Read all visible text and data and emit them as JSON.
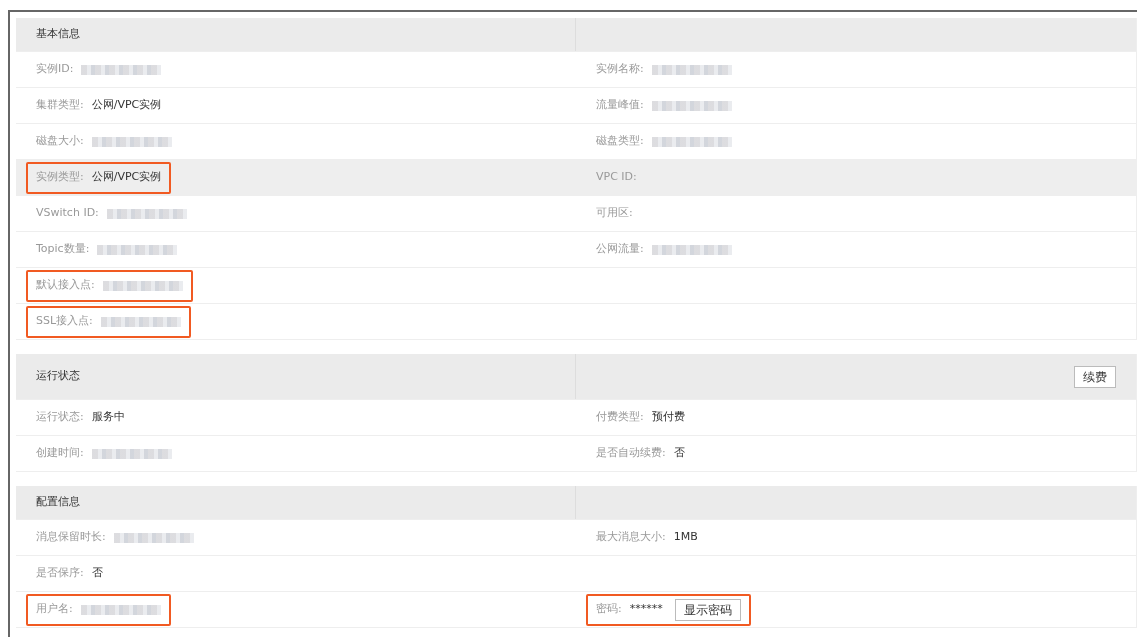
{
  "sections": [
    {
      "title": "基本信息",
      "rows": [
        {
          "shaded": false,
          "cells": [
            {
              "label": "实例ID:",
              "kind": "redacted",
              "highlighted": false
            },
            {
              "label": "实例名称:",
              "kind": "redacted",
              "highlighted": false
            }
          ]
        },
        {
          "shaded": false,
          "cells": [
            {
              "label": "集群类型:",
              "kind": "text",
              "value": "公网/VPC实例",
              "highlighted": false
            },
            {
              "label": "流量峰值:",
              "kind": "redacted",
              "highlighted": false
            }
          ]
        },
        {
          "shaded": false,
          "cells": [
            {
              "label": "磁盘大小:",
              "kind": "redacted",
              "highlighted": false
            },
            {
              "label": "磁盘类型:",
              "kind": "redacted",
              "highlighted": false
            }
          ]
        },
        {
          "shaded": true,
          "cells": [
            {
              "label": "实例类型:",
              "kind": "text",
              "value": "公网/VPC实例",
              "highlighted": true
            },
            {
              "label": "VPC ID:",
              "kind": "empty",
              "highlighted": false
            }
          ]
        },
        {
          "shaded": false,
          "cells": [
            {
              "label": "VSwitch ID:",
              "kind": "redacted",
              "highlighted": false
            },
            {
              "label": "可用区:",
              "kind": "empty",
              "highlighted": false
            }
          ]
        },
        {
          "shaded": false,
          "cells": [
            {
              "label": "Topic数量:",
              "kind": "redacted",
              "highlighted": false
            },
            {
              "label": "公网流量:",
              "kind": "redacted",
              "highlighted": false
            }
          ]
        },
        {
          "shaded": false,
          "cells": [
            {
              "label": "默认接入点:",
              "kind": "redacted",
              "highlighted": true
            }
          ]
        },
        {
          "shaded": false,
          "cells": [
            {
              "label": "SSL接入点:",
              "kind": "redacted",
              "highlighted": true
            }
          ]
        }
      ]
    },
    {
      "title": "运行状态",
      "action": "续费",
      "rows": [
        {
          "shaded": false,
          "cells": [
            {
              "label": "运行状态:",
              "kind": "text",
              "value": "服务中",
              "highlighted": false
            },
            {
              "label": "付费类型:",
              "kind": "text",
              "value": "预付费",
              "highlighted": false
            }
          ]
        },
        {
          "shaded": false,
          "cells": [
            {
              "label": "创建时间:",
              "kind": "redacted",
              "highlighted": false
            },
            {
              "label": "是否自动续费:",
              "kind": "text",
              "value": "否",
              "highlighted": false
            }
          ]
        }
      ]
    },
    {
      "title": "配置信息",
      "rows": [
        {
          "shaded": false,
          "cells": [
            {
              "label": "消息保留时长:",
              "kind": "redacted",
              "highlighted": false
            },
            {
              "label": "最大消息大小:",
              "kind": "text",
              "value": "1MB",
              "highlighted": false
            }
          ]
        },
        {
          "shaded": false,
          "cells": [
            {
              "label": "是否保序:",
              "kind": "text",
              "value": "否",
              "highlighted": false
            }
          ]
        },
        {
          "shaded": false,
          "cells": [
            {
              "label": "用户名:",
              "kind": "redacted",
              "highlighted": true
            },
            {
              "label": "密码:",
              "kind": "secret",
              "value": "******",
              "button": "显示密码",
              "highlighted": true
            }
          ]
        }
      ]
    }
  ]
}
